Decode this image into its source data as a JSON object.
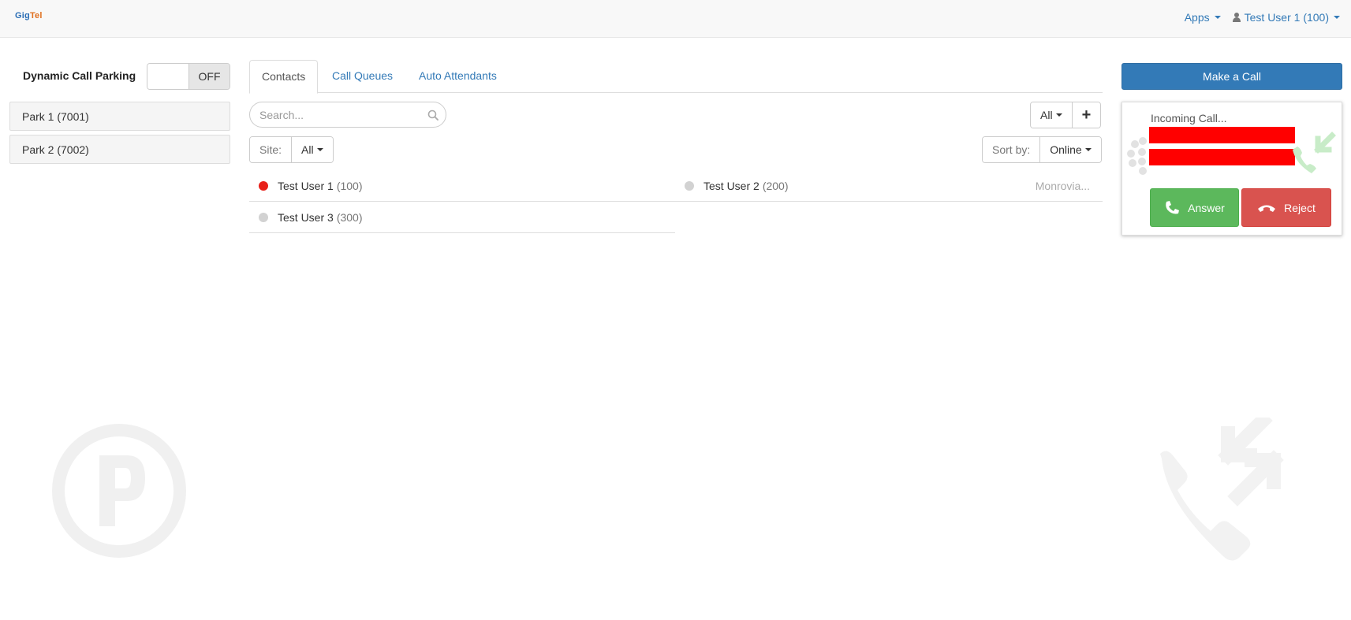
{
  "navbar": {
    "logo_text_a": "Gig",
    "logo_text_b": "Tel",
    "apps_label": "Apps",
    "user_label": "Test User 1 (100)"
  },
  "parking": {
    "title": "Dynamic Call Parking",
    "toggle_state": "OFF",
    "items": [
      {
        "label": "Park 1 (7001)"
      },
      {
        "label": "Park 2 (7002)"
      }
    ]
  },
  "tabs": [
    {
      "label": "Contacts",
      "active": true
    },
    {
      "label": "Call Queues",
      "active": false
    },
    {
      "label": "Auto Attendants",
      "active": false
    }
  ],
  "search": {
    "placeholder": "Search..."
  },
  "filters": {
    "all_label": "All",
    "add_label": "+",
    "site_label": "Site:",
    "site_value": "All",
    "sort_label": "Sort by:",
    "sort_value": "Online"
  },
  "contacts": [
    {
      "name": "Test User 1",
      "ext": "(100)",
      "status": "busy",
      "site": ""
    },
    {
      "name": "Test User 2",
      "ext": "(200)",
      "status": "offline",
      "site": "Monrovia..."
    },
    {
      "name": "Test User 3",
      "ext": "(300)",
      "status": "offline",
      "site": ""
    }
  ],
  "call_panel": {
    "make_call_label": "Make a Call",
    "incoming_label": "Incoming Call...",
    "answer_label": "Answer",
    "reject_label": "Reject"
  },
  "colors": {
    "primary": "#337ab7",
    "success": "#5cb85c",
    "danger": "#d9534f",
    "busy": "#e8211a",
    "redaction": "#ff0000"
  }
}
